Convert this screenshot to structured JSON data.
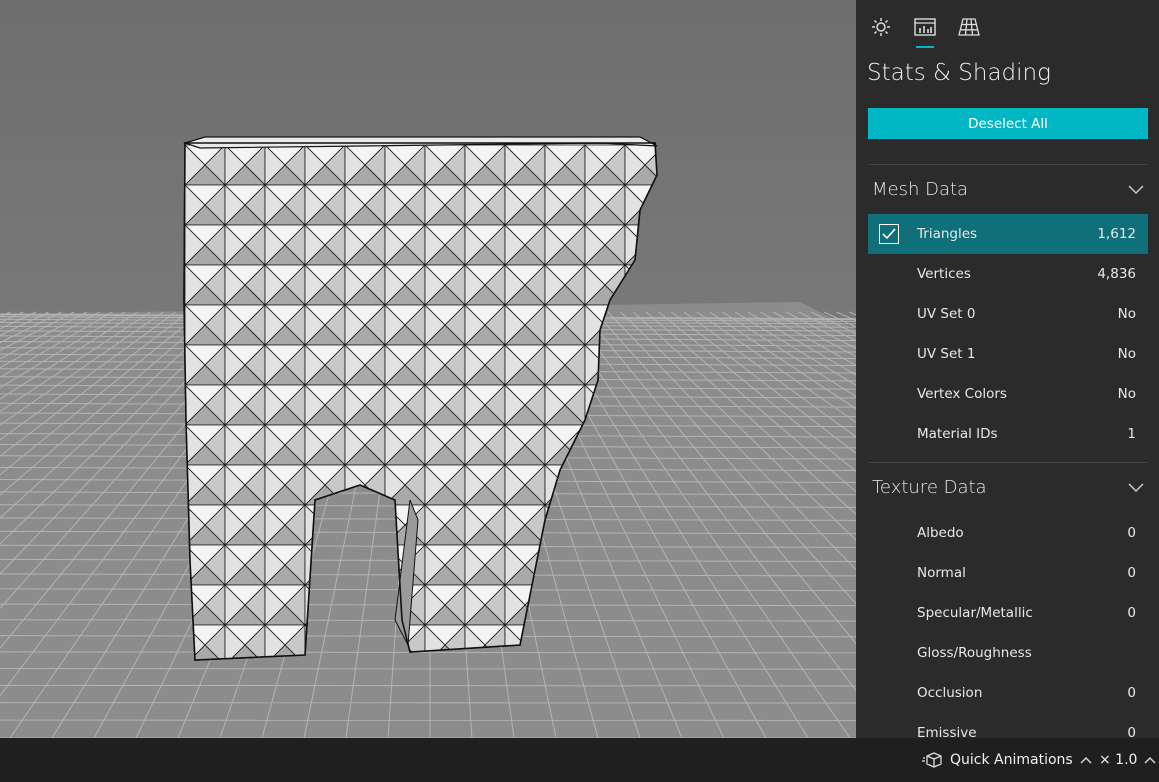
{
  "panel": {
    "tabs": [
      {
        "name": "lighting-tab",
        "icon": "sun-icon"
      },
      {
        "name": "stats-tab",
        "icon": "stats-icon",
        "active": true
      },
      {
        "name": "grid-tab",
        "icon": "grid-icon"
      }
    ],
    "title": "Stats & Shading",
    "deselect_label": "Deselect All",
    "mesh_section": {
      "title": "Mesh Data",
      "rows": [
        {
          "name": "Triangles",
          "value": "1,612",
          "selected": true
        },
        {
          "name": "Vertices",
          "value": "4,836"
        },
        {
          "name": "UV Set 0",
          "value": "No"
        },
        {
          "name": "UV Set 1",
          "value": "No"
        },
        {
          "name": "Vertex Colors",
          "value": "No"
        },
        {
          "name": "Material IDs",
          "value": "1"
        }
      ]
    },
    "texture_section": {
      "title": "Texture Data",
      "rows": [
        {
          "name": "Albedo",
          "value": "0"
        },
        {
          "name": "Normal",
          "value": "0"
        },
        {
          "name": "Specular/Metallic",
          "value": "0"
        },
        {
          "name": "Gloss/Roughness",
          "value": ""
        },
        {
          "name": "Occlusion",
          "value": "0"
        },
        {
          "name": "Emissive",
          "value": "0"
        }
      ]
    }
  },
  "statusbar": {
    "quick_animations_label": "Quick Animations",
    "speed_label": "× 1.0"
  },
  "colors": {
    "accent": "#00b7c3",
    "selected_row": "#10707a",
    "panel_bg": "#2b2b2b"
  }
}
